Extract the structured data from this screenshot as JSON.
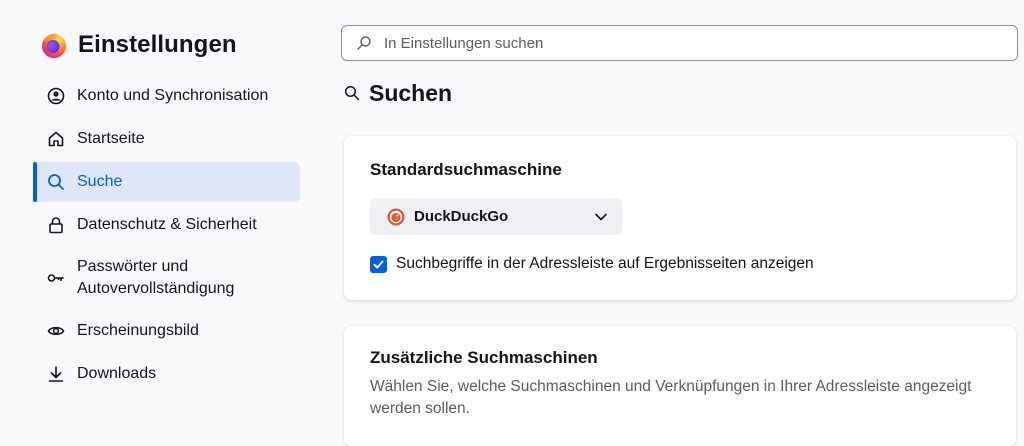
{
  "app": {
    "title": "Einstellungen"
  },
  "sidebar": {
    "items": [
      {
        "label": "Konto und Synchronisation",
        "icon": "account-icon",
        "active": false
      },
      {
        "label": "Startseite",
        "icon": "home-icon",
        "active": false
      },
      {
        "label": "Suche",
        "icon": "search-icon",
        "active": true
      },
      {
        "label": "Datenschutz & Sicherheit",
        "icon": "lock-icon",
        "active": false
      },
      {
        "label": "Passwörter und Autovervollständigung",
        "icon": "key-icon",
        "active": false
      },
      {
        "label": "Erscheinungsbild",
        "icon": "eye-icon",
        "active": false
      },
      {
        "label": "Downloads",
        "icon": "download-icon",
        "active": false
      }
    ]
  },
  "search": {
    "placeholder": "In Einstellungen suchen",
    "value": ""
  },
  "main": {
    "heading": "Suchen",
    "default_engine": {
      "title": "Standardsuchmaschine",
      "selected": "DuckDuckGo",
      "checkbox_label": "Suchbegriffe in der Adressleiste auf Ergebnisseiten anzeigen",
      "checkbox_checked": true
    },
    "additional_engines": {
      "title": "Zusätzliche Suchmaschinen",
      "description": "Wählen Sie, welche Suchmaschinen und Verknüpfungen in Ihrer Adressleiste angezeigt werden sollen."
    }
  },
  "colors": {
    "accent": "#0061e0",
    "active_bg": "#e0e6f9",
    "page_bg": "#f9f9fb"
  }
}
